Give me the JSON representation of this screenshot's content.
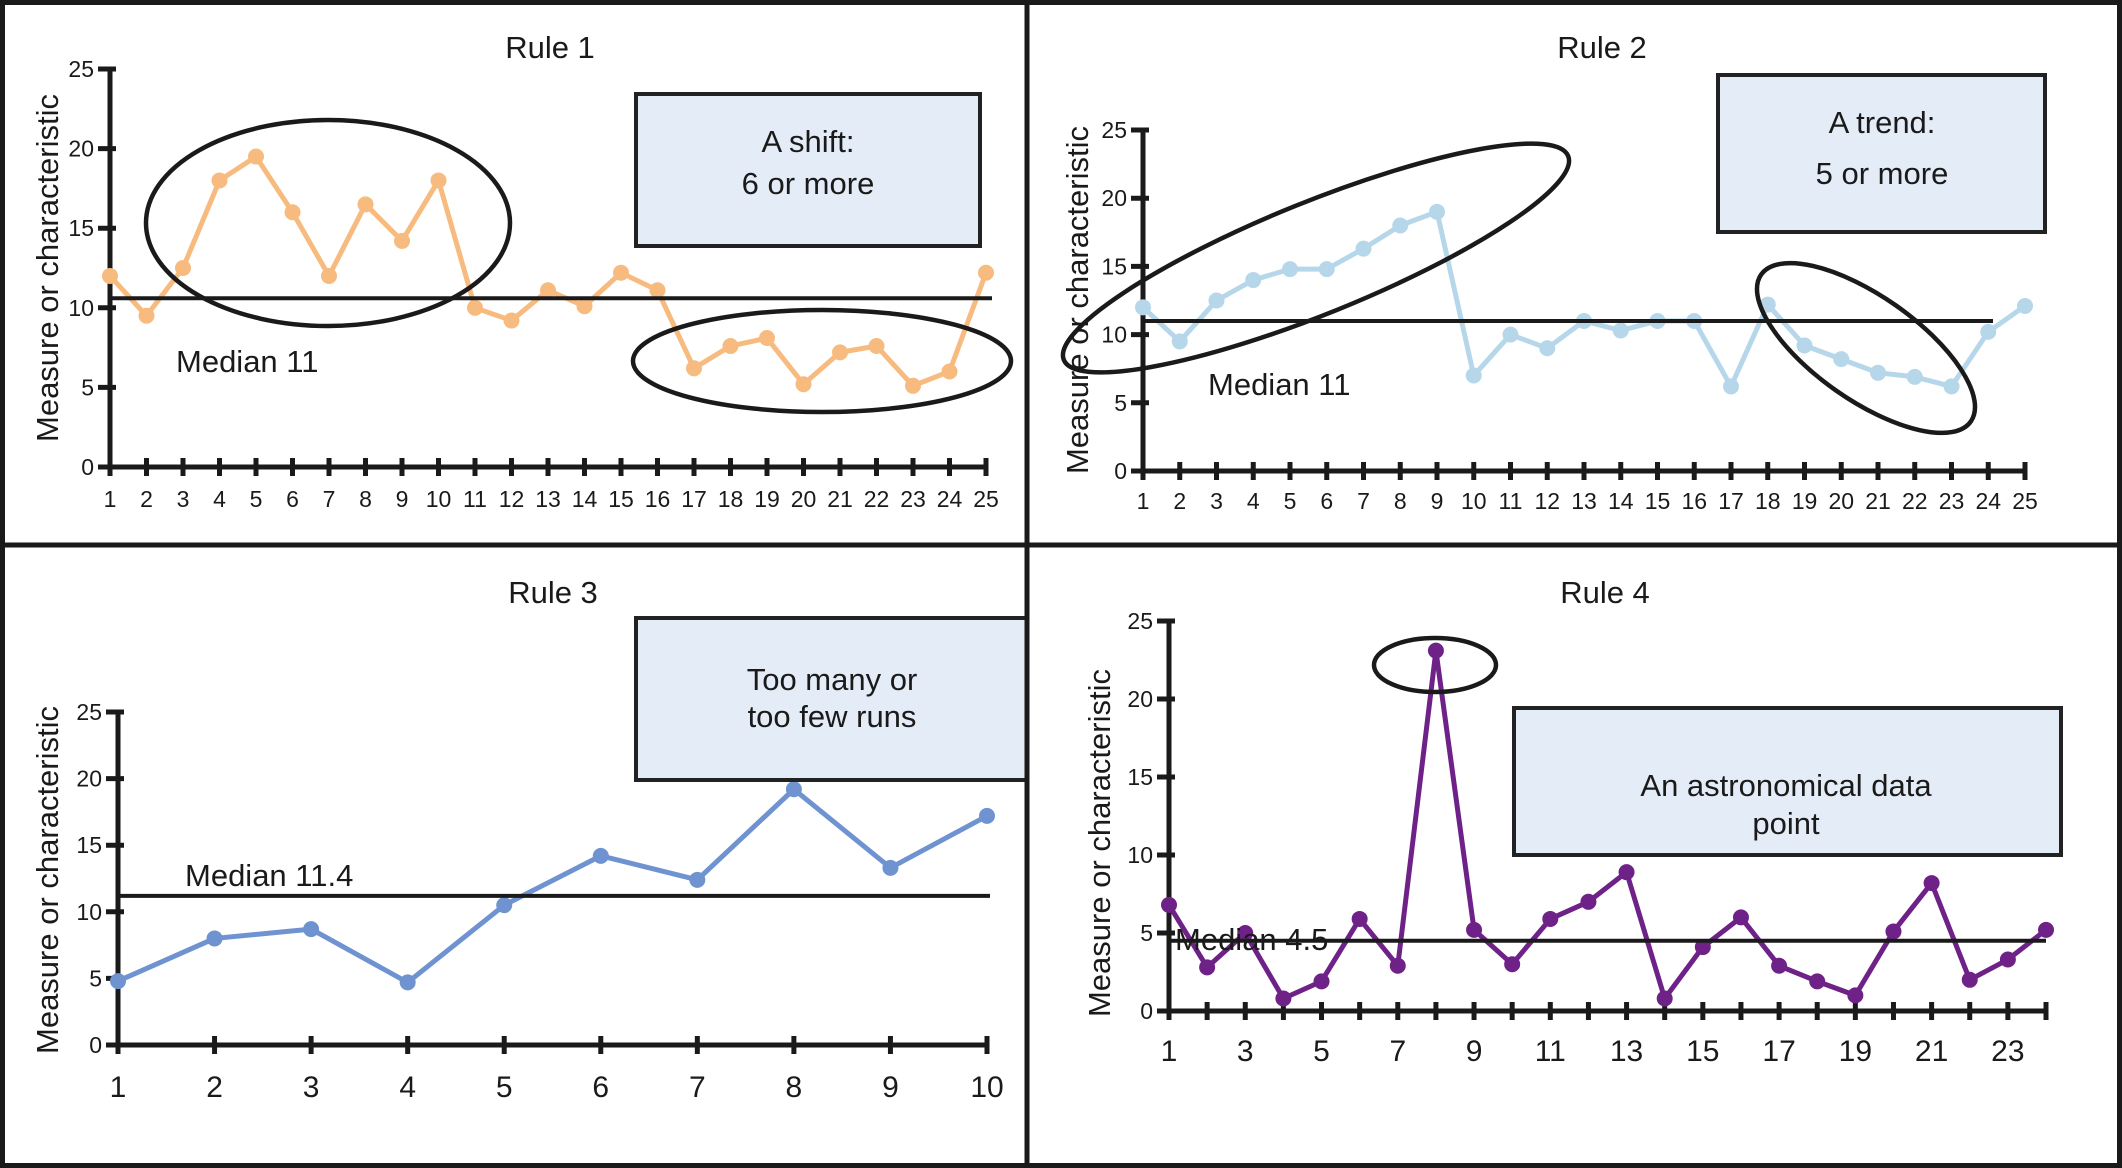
{
  "chart_data": [
    {
      "type": "line",
      "title": "Rule 1",
      "xlabel": "",
      "ylabel": "Measure or characteristic",
      "ylim": [
        0,
        25
      ],
      "yticks": [
        "0",
        "5",
        "10",
        "15",
        "20",
        "25"
      ],
      "x": [
        1,
        2,
        3,
        4,
        5,
        6,
        7,
        8,
        9,
        10,
        11,
        12,
        13,
        14,
        15,
        16,
        17,
        18,
        19,
        20,
        21,
        22,
        23,
        24,
        25
      ],
      "xticks": [
        "1",
        "2",
        "3",
        "4",
        "5",
        "6",
        "7",
        "8",
        "9",
        "10",
        "11",
        "12",
        "13",
        "14",
        "15",
        "16",
        "17",
        "18",
        "19",
        "20",
        "21",
        "22",
        "23",
        "24",
        "25"
      ],
      "series": [
        {
          "name": "Measure",
          "color": "#f7bb80",
          "values": [
            12,
            9.5,
            12.5,
            18,
            19.5,
            16,
            12,
            16.5,
            14.2,
            18,
            10,
            9.2,
            11.1,
            10.1,
            12.2,
            11.1,
            6.2,
            7.6,
            8.1,
            5.2,
            7.2,
            7.6,
            5.1,
            6,
            12.2
          ]
        }
      ],
      "median": {
        "value": 10.6,
        "label": "Median 11"
      },
      "callout": [
        "A shift:",
        "6 or more"
      ],
      "highlight_ranges": [
        [
          3,
          10
        ],
        [
          17,
          24
        ]
      ],
      "grid": false
    },
    {
      "type": "line",
      "title": "Rule 2",
      "xlabel": "",
      "ylabel": "Measure or characteristic",
      "ylim": [
        0,
        25
      ],
      "yticks": [
        "0",
        "5",
        "10",
        "15",
        "20",
        "25"
      ],
      "x": [
        1,
        2,
        3,
        4,
        5,
        6,
        7,
        8,
        9,
        10,
        11,
        12,
        13,
        14,
        15,
        16,
        17,
        18,
        19,
        20,
        21,
        22,
        23,
        24,
        25
      ],
      "xticks": [
        "1",
        "2",
        "3",
        "4",
        "5",
        "6",
        "7",
        "8",
        "9",
        "10",
        "11",
        "12",
        "13",
        "14",
        "15",
        "16",
        "17",
        "18",
        "19",
        "20",
        "21",
        "22",
        "23",
        "24",
        "25"
      ],
      "series": [
        {
          "name": "Measure",
          "color": "#b6d7ea",
          "values": [
            12,
            9.5,
            12.5,
            14,
            14.8,
            14.8,
            16.3,
            18,
            19,
            7,
            10,
            9,
            11,
            10.3,
            11,
            11,
            6.2,
            12.2,
            9.2,
            8.2,
            7.2,
            6.9,
            6.2,
            10.2,
            12.1
          ]
        }
      ],
      "median": {
        "value": 11,
        "label": "Median 11"
      },
      "callout": [
        "A trend:",
        "5 or more"
      ],
      "highlight_ranges": [
        [
          2,
          9
        ],
        [
          18,
          23
        ]
      ],
      "grid": false
    },
    {
      "type": "line",
      "title": "Rule 3",
      "xlabel": "",
      "ylabel": "Measure or characteristic",
      "ylim": [
        0,
        25
      ],
      "yticks": [
        "0",
        "5",
        "10",
        "15",
        "20",
        "25"
      ],
      "x": [
        1,
        2,
        3,
        4,
        5,
        6,
        7,
        8,
        9,
        10
      ],
      "xticks": [
        "1",
        "2",
        "3",
        "4",
        "5",
        "6",
        "7",
        "8",
        "9",
        "10"
      ],
      "series": [
        {
          "name": "Measure",
          "color": "#6f93d0",
          "values": [
            4.8,
            8,
            8.7,
            4.7,
            10.5,
            14.2,
            12.4,
            19.2,
            13.3,
            17.2
          ]
        }
      ],
      "median": {
        "value": 11.2,
        "label": "Median 11.4"
      },
      "callout": [
        "Too many or",
        "too few runs"
      ],
      "highlight_ranges": [],
      "grid": false
    },
    {
      "type": "line",
      "title": "Rule 4",
      "xlabel": "",
      "ylabel": "Measure or characteristic",
      "ylim": [
        0,
        25
      ],
      "yticks": [
        "0",
        "5",
        "10",
        "15",
        "20",
        "25"
      ],
      "x": [
        1,
        2,
        3,
        4,
        5,
        6,
        7,
        8,
        9,
        10,
        11,
        12,
        13,
        14,
        15,
        16,
        17,
        18,
        19,
        20,
        21,
        22,
        23,
        24
      ],
      "xticks": [
        "1",
        "",
        "3",
        "",
        "5",
        "",
        "7",
        "",
        "9",
        "",
        "11",
        "",
        "13",
        "",
        "15",
        "",
        "17",
        "",
        "19",
        "",
        "21",
        "",
        "23",
        ""
      ],
      "series": [
        {
          "name": "Measure",
          "color": "#6e2287",
          "values": [
            6.8,
            2.8,
            5,
            0.8,
            1.9,
            5.9,
            2.9,
            23.1,
            5.2,
            3,
            5.9,
            7,
            8.9,
            0.8,
            4.1,
            6,
            2.9,
            1.9,
            1,
            5.1,
            8.2,
            2,
            3.3,
            5.2
          ]
        }
      ],
      "median": {
        "value": 4.5,
        "label": "Median 4.5"
      },
      "callout": [
        "An astronomical data",
        "point"
      ],
      "highlight_ranges": [
        [
          8,
          8
        ]
      ],
      "grid": false
    }
  ]
}
